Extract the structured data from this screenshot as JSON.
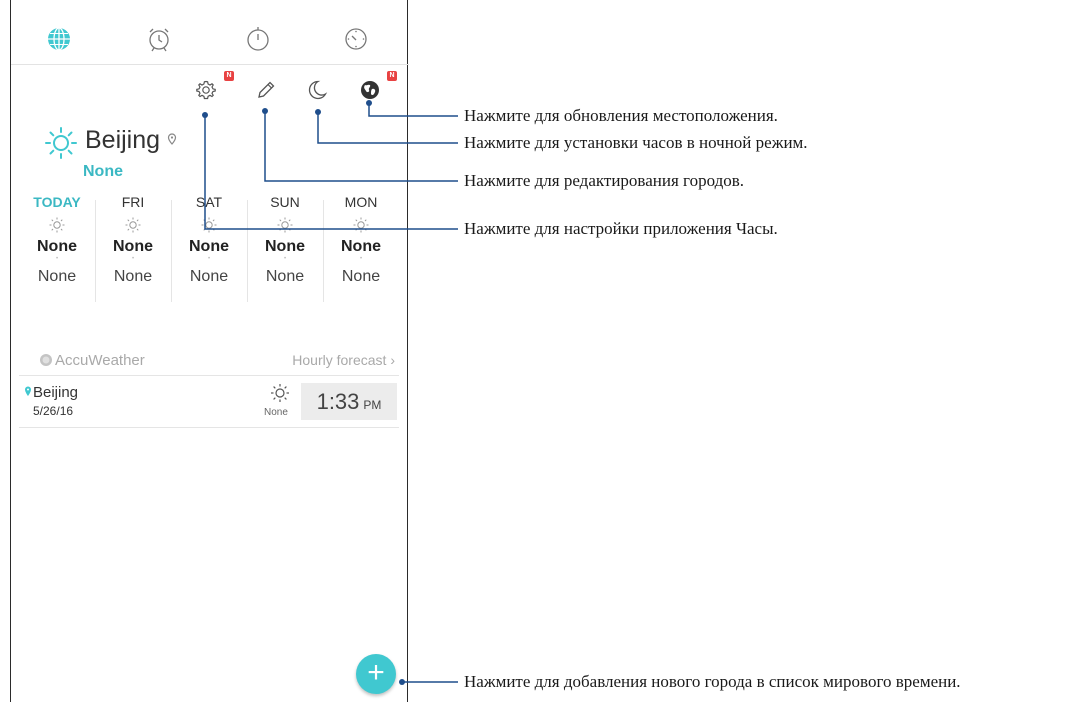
{
  "tabs": [
    {
      "name": "world-clock",
      "active": true
    },
    {
      "name": "alarm",
      "active": false
    },
    {
      "name": "stopwatch",
      "active": false
    },
    {
      "name": "timer",
      "active": false
    }
  ],
  "toolbar": {
    "settings_badge": "N",
    "location_badge": "N"
  },
  "weather": {
    "city": "Beijing",
    "condition": "None"
  },
  "forecast": [
    {
      "day": "TODAY",
      "high": "None",
      "low": "None"
    },
    {
      "day": "FRI",
      "high": "None",
      "low": "None"
    },
    {
      "day": "SAT",
      "high": "None",
      "low": "None"
    },
    {
      "day": "SUN",
      "high": "None",
      "low": "None"
    },
    {
      "day": "MON",
      "high": "None",
      "low": "None"
    }
  ],
  "provider": "AccuWeather",
  "hourly_link": "Hourly forecast",
  "world_clock": {
    "city": "Beijing",
    "date": "5/26/16",
    "weather": "None",
    "time": "1:33",
    "ampm": "PM"
  },
  "fab_label": "+",
  "callouts": {
    "location": "Нажмите для обновления местоположения.",
    "night": "Нажмите для установки часов в ночной режим.",
    "edit": "Нажмите для редактирования городов.",
    "settings": "Нажмите для настройки приложения Часы.",
    "add": "Нажмите для добавления нового города в список мирового времени."
  },
  "colors": {
    "accent": "#40c8d0",
    "accent_text": "#3bb8c3",
    "badge": "#e84242",
    "callout_line": "#1f4e8c"
  }
}
